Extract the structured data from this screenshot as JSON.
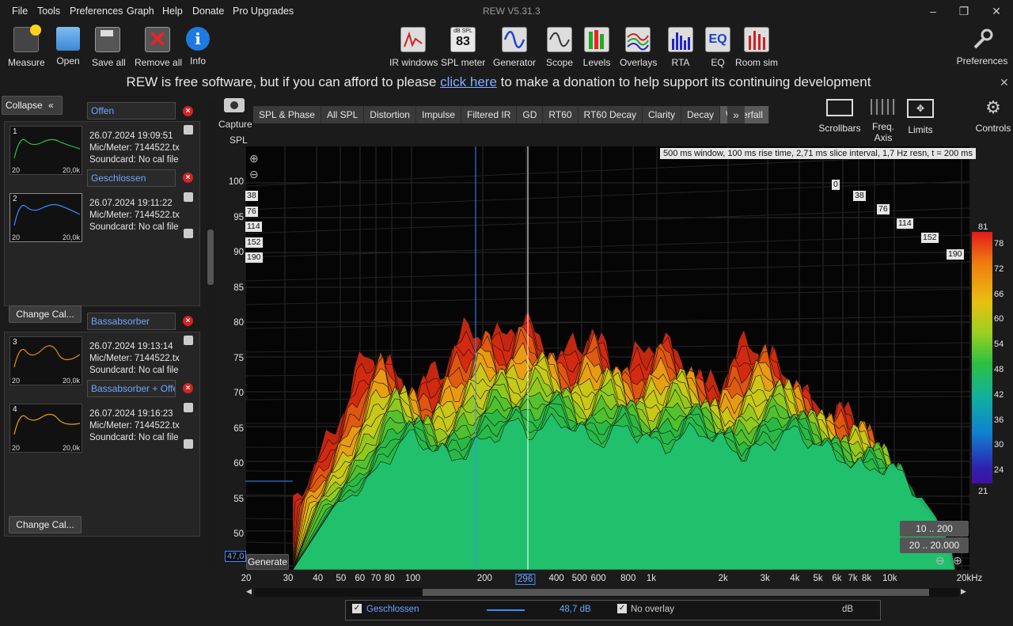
{
  "menu": {
    "items": [
      "File",
      "Tools",
      "Preferences",
      "Graph",
      "Help",
      "Donate",
      "Pro Upgrades"
    ]
  },
  "window": {
    "title": "REW V5.31.3"
  },
  "toolbar": {
    "left": [
      "Measure",
      "Open",
      "Save all",
      "Remove all",
      "Info"
    ],
    "center": [
      "IR windows",
      "SPL meter",
      "Generator",
      "Scope",
      "Levels",
      "Overlays",
      "RTA",
      "EQ",
      "Room sim"
    ],
    "right": [
      "Preferences"
    ],
    "spl_meter_caption": "dB SPL",
    "spl_meter_value": "83",
    "eq_text": "EQ"
  },
  "donation": {
    "before": "REW is free software, but if you can afford to please ",
    "link": "click here",
    "after": " to make a donation to help support its continuing development"
  },
  "panel": {
    "collapse_label": "Collapse",
    "change_cal_label": "Change Cal...",
    "measurements": [
      {
        "num": "1",
        "name": "Offen",
        "date": "26.07.2024 19:09:51",
        "mic": "Mic/Meter: 7144522.tx",
        "soundcard": "Soundcard: No cal file",
        "x0": "20",
        "x1": "20,0k",
        "color": "#2fbf3f"
      },
      {
        "num": "2",
        "name": "Geschlossen",
        "date": "26.07.2024 19:11:22",
        "mic": "Mic/Meter: 7144522.tx",
        "soundcard": "Soundcard: No cal file",
        "x0": "20",
        "x1": "20,0k",
        "color": "#3a8cff"
      },
      {
        "num": "3",
        "name": "Bassabsorber",
        "date": "26.07.2024 19:13:14",
        "mic": "Mic/Meter: 7144522.tx",
        "soundcard": "Soundcard: No cal file",
        "x0": "20",
        "x1": "20,0k",
        "color": "#e08a20"
      },
      {
        "num": "4",
        "name": "Bassabsorber + Offen",
        "date": "26.07.2024 19:16:23",
        "mic": "Mic/Meter: 7144522.tx",
        "soundcard": "Soundcard: No cal file",
        "x0": "20",
        "x1": "20,0k",
        "color": "#e0a020"
      }
    ]
  },
  "graph": {
    "capture_label": "Capture",
    "tabs": [
      "SPL & Phase",
      "All SPL",
      "Distortion",
      "Impulse",
      "Filtered IR",
      "GD",
      "RT60",
      "RT60 Decay",
      "Clarity",
      "Decay",
      "Waterfall"
    ],
    "active_tab": "Waterfall",
    "more_label": "»",
    "controls": [
      "Scrollbars",
      "Freq. Axis",
      "Limits",
      "Controls"
    ],
    "y_axis_label": "SPL",
    "info": "500 ms window, 100 ms rise time, 2,71 ms slice interval, 1,7 Hz resn, t = 200 ms",
    "y_ticks": [
      "100",
      "95",
      "90",
      "85",
      "80",
      "75",
      "70",
      "65",
      "60",
      "55",
      "50"
    ],
    "x_ticks": [
      "20",
      "30",
      "40",
      "50",
      "60",
      "70",
      "80",
      "100",
      "200",
      "296",
      "400",
      "500",
      "600",
      "800",
      "1k",
      "2k",
      "3k",
      "4k",
      "5k",
      "6k",
      "7k",
      "8k",
      "10k",
      "20kHz"
    ],
    "cursor_x": "296",
    "cursor_y": "47,0",
    "time_labels_left": [
      "38",
      "76",
      "114",
      "152",
      "190"
    ],
    "time_labels_right": [
      "0",
      "38",
      "76",
      "114",
      "152",
      "190"
    ],
    "colorbar": {
      "max": "81",
      "min": "21",
      "ticks": [
        "78",
        "72",
        "66",
        "60",
        "54",
        "48",
        "42",
        "36",
        "30",
        "24"
      ]
    },
    "range_buttons": [
      "10 .. 200",
      "20 .. 20.000"
    ],
    "generate_label": "Generate"
  },
  "statusbar": {
    "name": "Geschlossen",
    "level": "48,7 dB",
    "overlay": "No overlay",
    "unit": "dB"
  }
}
